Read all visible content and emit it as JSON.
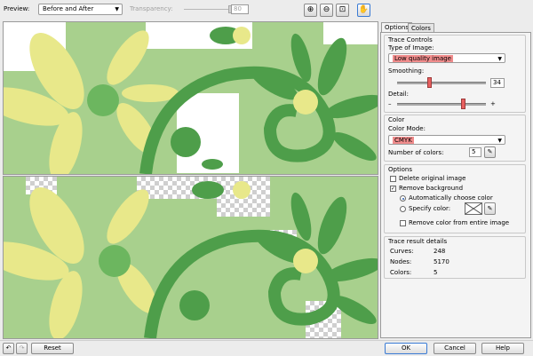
{
  "toolbar": {
    "preview_label": "Preview:",
    "preview_value": "Before and After",
    "transparency_label": "Transparency:",
    "transparency_value": "80",
    "zoom_in_icon": "zoom-in-icon",
    "zoom_out_icon": "zoom-out-icon",
    "zoom_fit_icon": "zoom-fit-icon",
    "pan_icon": "pan-hand-icon"
  },
  "tabs": [
    {
      "label": "Options",
      "active": true
    },
    {
      "label": "Colors",
      "active": false
    }
  ],
  "trace_controls": {
    "title": "Trace Controls",
    "type_label": "Type of Image:",
    "type_value": "Low quality image",
    "smoothing_label": "Smoothing:",
    "smoothing_value": "34",
    "detail_label": "Detail:",
    "detail_minus": "–",
    "detail_plus": "+"
  },
  "color": {
    "title": "Color",
    "mode_label": "Color Mode:",
    "mode_value": "CMYK",
    "num_label": "Number of colors:",
    "num_value": "5"
  },
  "options": {
    "title": "Options",
    "delete_original": "Delete original image",
    "delete_checked": false,
    "remove_background": "Remove background",
    "remove_checked": true,
    "auto_color": "Automatically choose color",
    "specify_color": "Specify color:",
    "remove_entire": "Remove color from entire image"
  },
  "results": {
    "title": "Trace result details",
    "curves_label": "Curves:",
    "curves_value": "248",
    "nodes_label": "Nodes:",
    "nodes_value": "5170",
    "colors_label": "Colors:",
    "colors_value": "5"
  },
  "bottom": {
    "reset": "Reset",
    "ok": "OK",
    "cancel": "Cancel",
    "help": "Help"
  },
  "palette": {
    "light_green": "#a8d08d",
    "pale_green": "#c9e3b2",
    "dark_green": "#4e9e4a",
    "mid_green": "#6cb65f",
    "yellow": "#e8e88a",
    "highlight": "#f08c8c"
  }
}
